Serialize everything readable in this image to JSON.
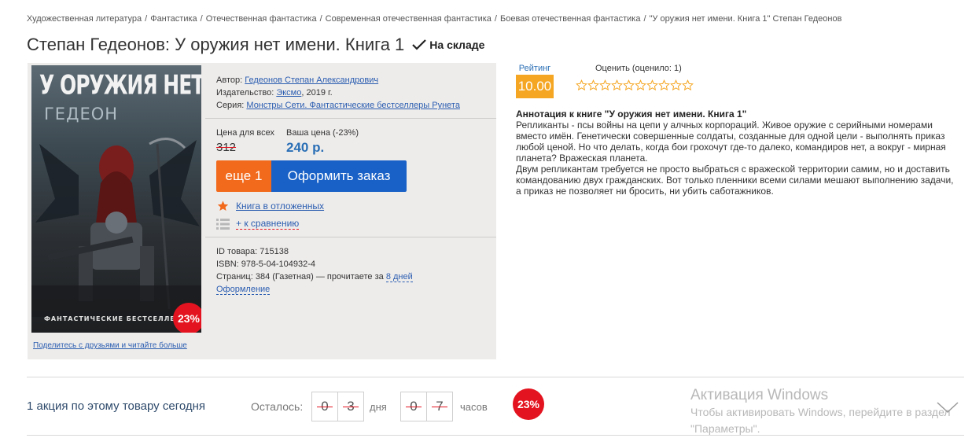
{
  "breadcrumb": [
    "Художественная литература",
    "Фантастика",
    "Отечественная фантастика",
    "Современная отечественная фантастика",
    "Боевая отечественная фантастика",
    "\"У оружия нет имени. Книга 1\" Степан Гедеонов"
  ],
  "product": {
    "title": "Степан Гедеонов: У оружия нет имени. Книга 1",
    "stock": "На складе"
  },
  "cover": {
    "title": "У ОРУЖИЯ НЕТ ИМЕНИ",
    "author": "ГЕДЕОН",
    "series": "ФАНТАСТИЧЕСКИЕ БЕСТСЕЛЛЕРЫ",
    "discount": "23%",
    "share_link": "Поделитесь с друзьями и читайте больше"
  },
  "info": {
    "author_label": "Автор:",
    "author": "Гедеонов Степан Александрович",
    "publisher_label": "Издательство:",
    "publisher": "Эксмо",
    "year": ", 2019 г.",
    "series_label": "Серия:",
    "series": "Монстры Сети. Фантастические бестселлеры Рунета"
  },
  "price": {
    "all_label": "Цена для всех",
    "old": "312",
    "your_label": "Ваша цена (-23%)",
    "new": "240 р."
  },
  "actions": {
    "qty_label": "еще 1",
    "order_label": "Оформить заказ",
    "wishlist_label": "Книга в отложенных",
    "compare_label": "+ к сравнению"
  },
  "details": {
    "id": "ID товара: 715138",
    "isbn": "ISBN: 978-5-04-104932-4",
    "pages": "Страниц: 384 (Газетная) — прочитаете за ",
    "read_days": "8 дней",
    "design": "Оформление"
  },
  "rating": {
    "label": "Рейтинг",
    "value": "10.00",
    "rate_label": "Оценить (оценило: 1)",
    "stars_total": 10,
    "star_color": "#f5a623"
  },
  "annotation": {
    "title": "Аннотация к книге \"У оружия нет имени. Книга 1\"",
    "p1": "Репликанты - псы войны на цепи у алчных корпораций. Живое оружие с серийными номерами вместо имён. Генетически совершенные солдаты, созданные для одной цели - выполнять приказ любой ценой. Но что делать, когда бои грохочут где-то далеко, командиров нет, а вокруг - мирная планета? Вражеская планета.",
    "p2": "Двум репликантам требуется не просто выбраться с вражеской территории самим, но и доставить командованию двух гражданских. Вот только пленники всеми силами мешают выполнению задачи, а приказ не позволяет ни бросить, ни убить саботажников."
  },
  "promo": {
    "text": "1 акция по этому товару сегодня",
    "remain_label": "Осталось:",
    "days_digits": [
      "0",
      "3"
    ],
    "days_label": "дня",
    "hours_digits": [
      "0",
      "7"
    ],
    "hours_label": "часов",
    "discount": "23%"
  },
  "windows": {
    "title": "Активация Windows",
    "line1": "Чтобы активировать Windows, перейдите в раздел",
    "line2": "\"Параметры\"."
  }
}
